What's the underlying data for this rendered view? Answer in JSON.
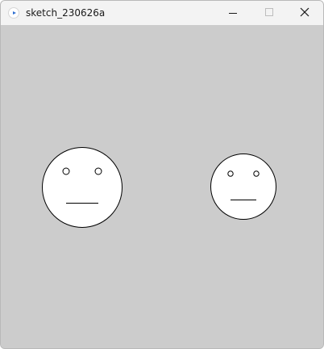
{
  "window": {
    "title": "sketch_230626a",
    "app_icon": "processing-play-icon",
    "controls": {
      "minimize_icon": "minimize-icon",
      "maximize_icon": "maximize-icon",
      "close_icon": "close-icon"
    }
  },
  "canvas": {
    "background_color": "#cccccc",
    "faces": [
      {
        "name": "face-left",
        "fill": "#ffffff",
        "stroke": "#000000"
      },
      {
        "name": "face-right",
        "fill": "#ffffff",
        "stroke": "#000000"
      }
    ]
  }
}
